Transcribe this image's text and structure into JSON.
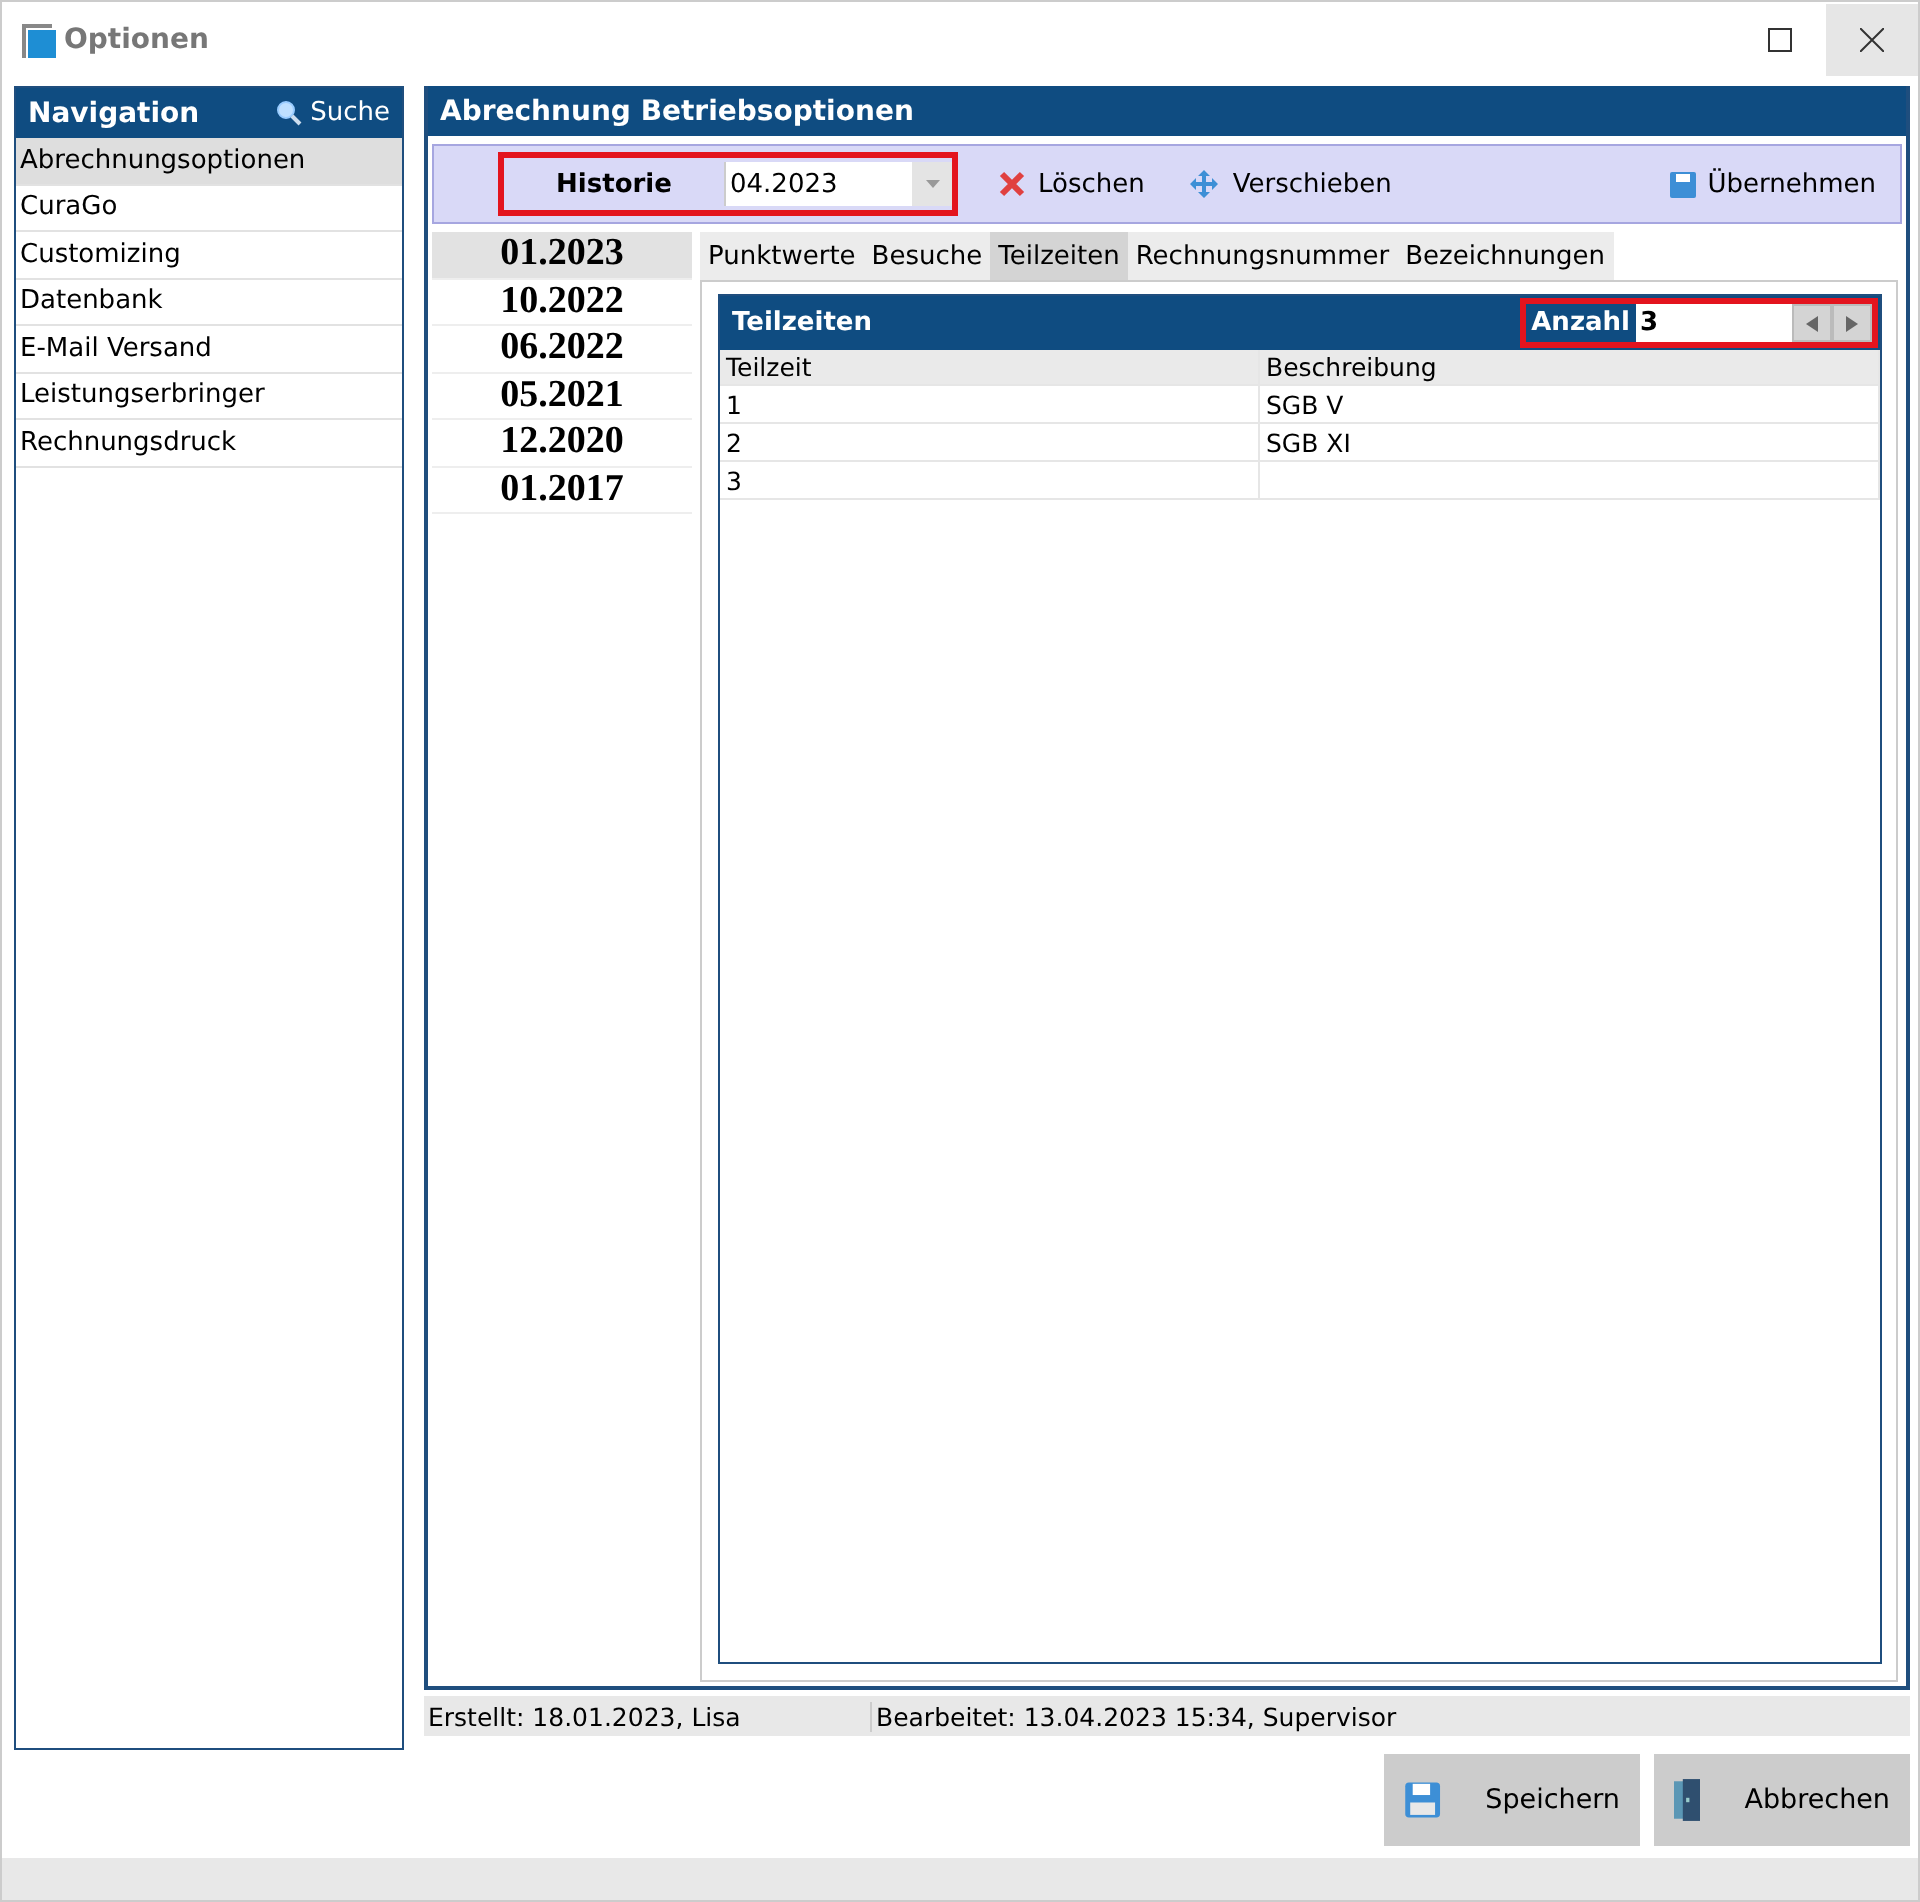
{
  "window": {
    "title": "Optionen"
  },
  "navigation": {
    "title": "Navigation",
    "search_label": "Suche",
    "items": [
      {
        "label": "Abrechnungsoptionen",
        "selected": true
      },
      {
        "label": "CuraGo",
        "selected": false
      },
      {
        "label": "Customizing",
        "selected": false
      },
      {
        "label": "Datenbank",
        "selected": false
      },
      {
        "label": "E-Mail Versand",
        "selected": false
      },
      {
        "label": "Leistungserbringer",
        "selected": false
      },
      {
        "label": "Rechnungsdruck",
        "selected": false
      }
    ]
  },
  "panel": {
    "title": "Abrechnung Betriebsoptionen",
    "toolbar": {
      "history_label": "Historie",
      "history_value": "04.2023",
      "buttons": [
        {
          "kind": "delete",
          "label": "Löschen"
        },
        {
          "kind": "move",
          "label": "Verschieben"
        }
      ],
      "apply_label": "Übernehmen"
    },
    "history": [
      {
        "label": "01.2023",
        "selected": true
      },
      {
        "label": "10.2022",
        "selected": false
      },
      {
        "label": "06.2022",
        "selected": false
      },
      {
        "label": "05.2021",
        "selected": false
      },
      {
        "label": "12.2020",
        "selected": false
      },
      {
        "label": "01.2017",
        "selected": false
      }
    ],
    "tabs": [
      {
        "label": "Punktwerte",
        "selected": false
      },
      {
        "label": "Besuche",
        "selected": false
      },
      {
        "label": "Teilzeiten",
        "selected": true
      },
      {
        "label": "Rechnungsnummer",
        "selected": false
      },
      {
        "label": "Bezeichnungen",
        "selected": false
      }
    ],
    "grid": {
      "title": "Teilzeiten",
      "count_label": "Anzahl",
      "count_value": "3",
      "columns": [
        "Teilzeit",
        "Beschreibung"
      ],
      "rows": [
        [
          "1",
          "SGB V"
        ],
        [
          "2",
          "SGB XI"
        ],
        [
          "3",
          ""
        ]
      ]
    }
  },
  "status_bar": [
    "Erstellt: 18.01.2023, Lisa",
    "Bearbeitet: 13.04.2023 15:34, Supervisor"
  ],
  "buttons": [
    {
      "kind": "save",
      "label": "Speichern"
    },
    {
      "kind": "cancel",
      "label": "Abbrechen"
    }
  ]
}
